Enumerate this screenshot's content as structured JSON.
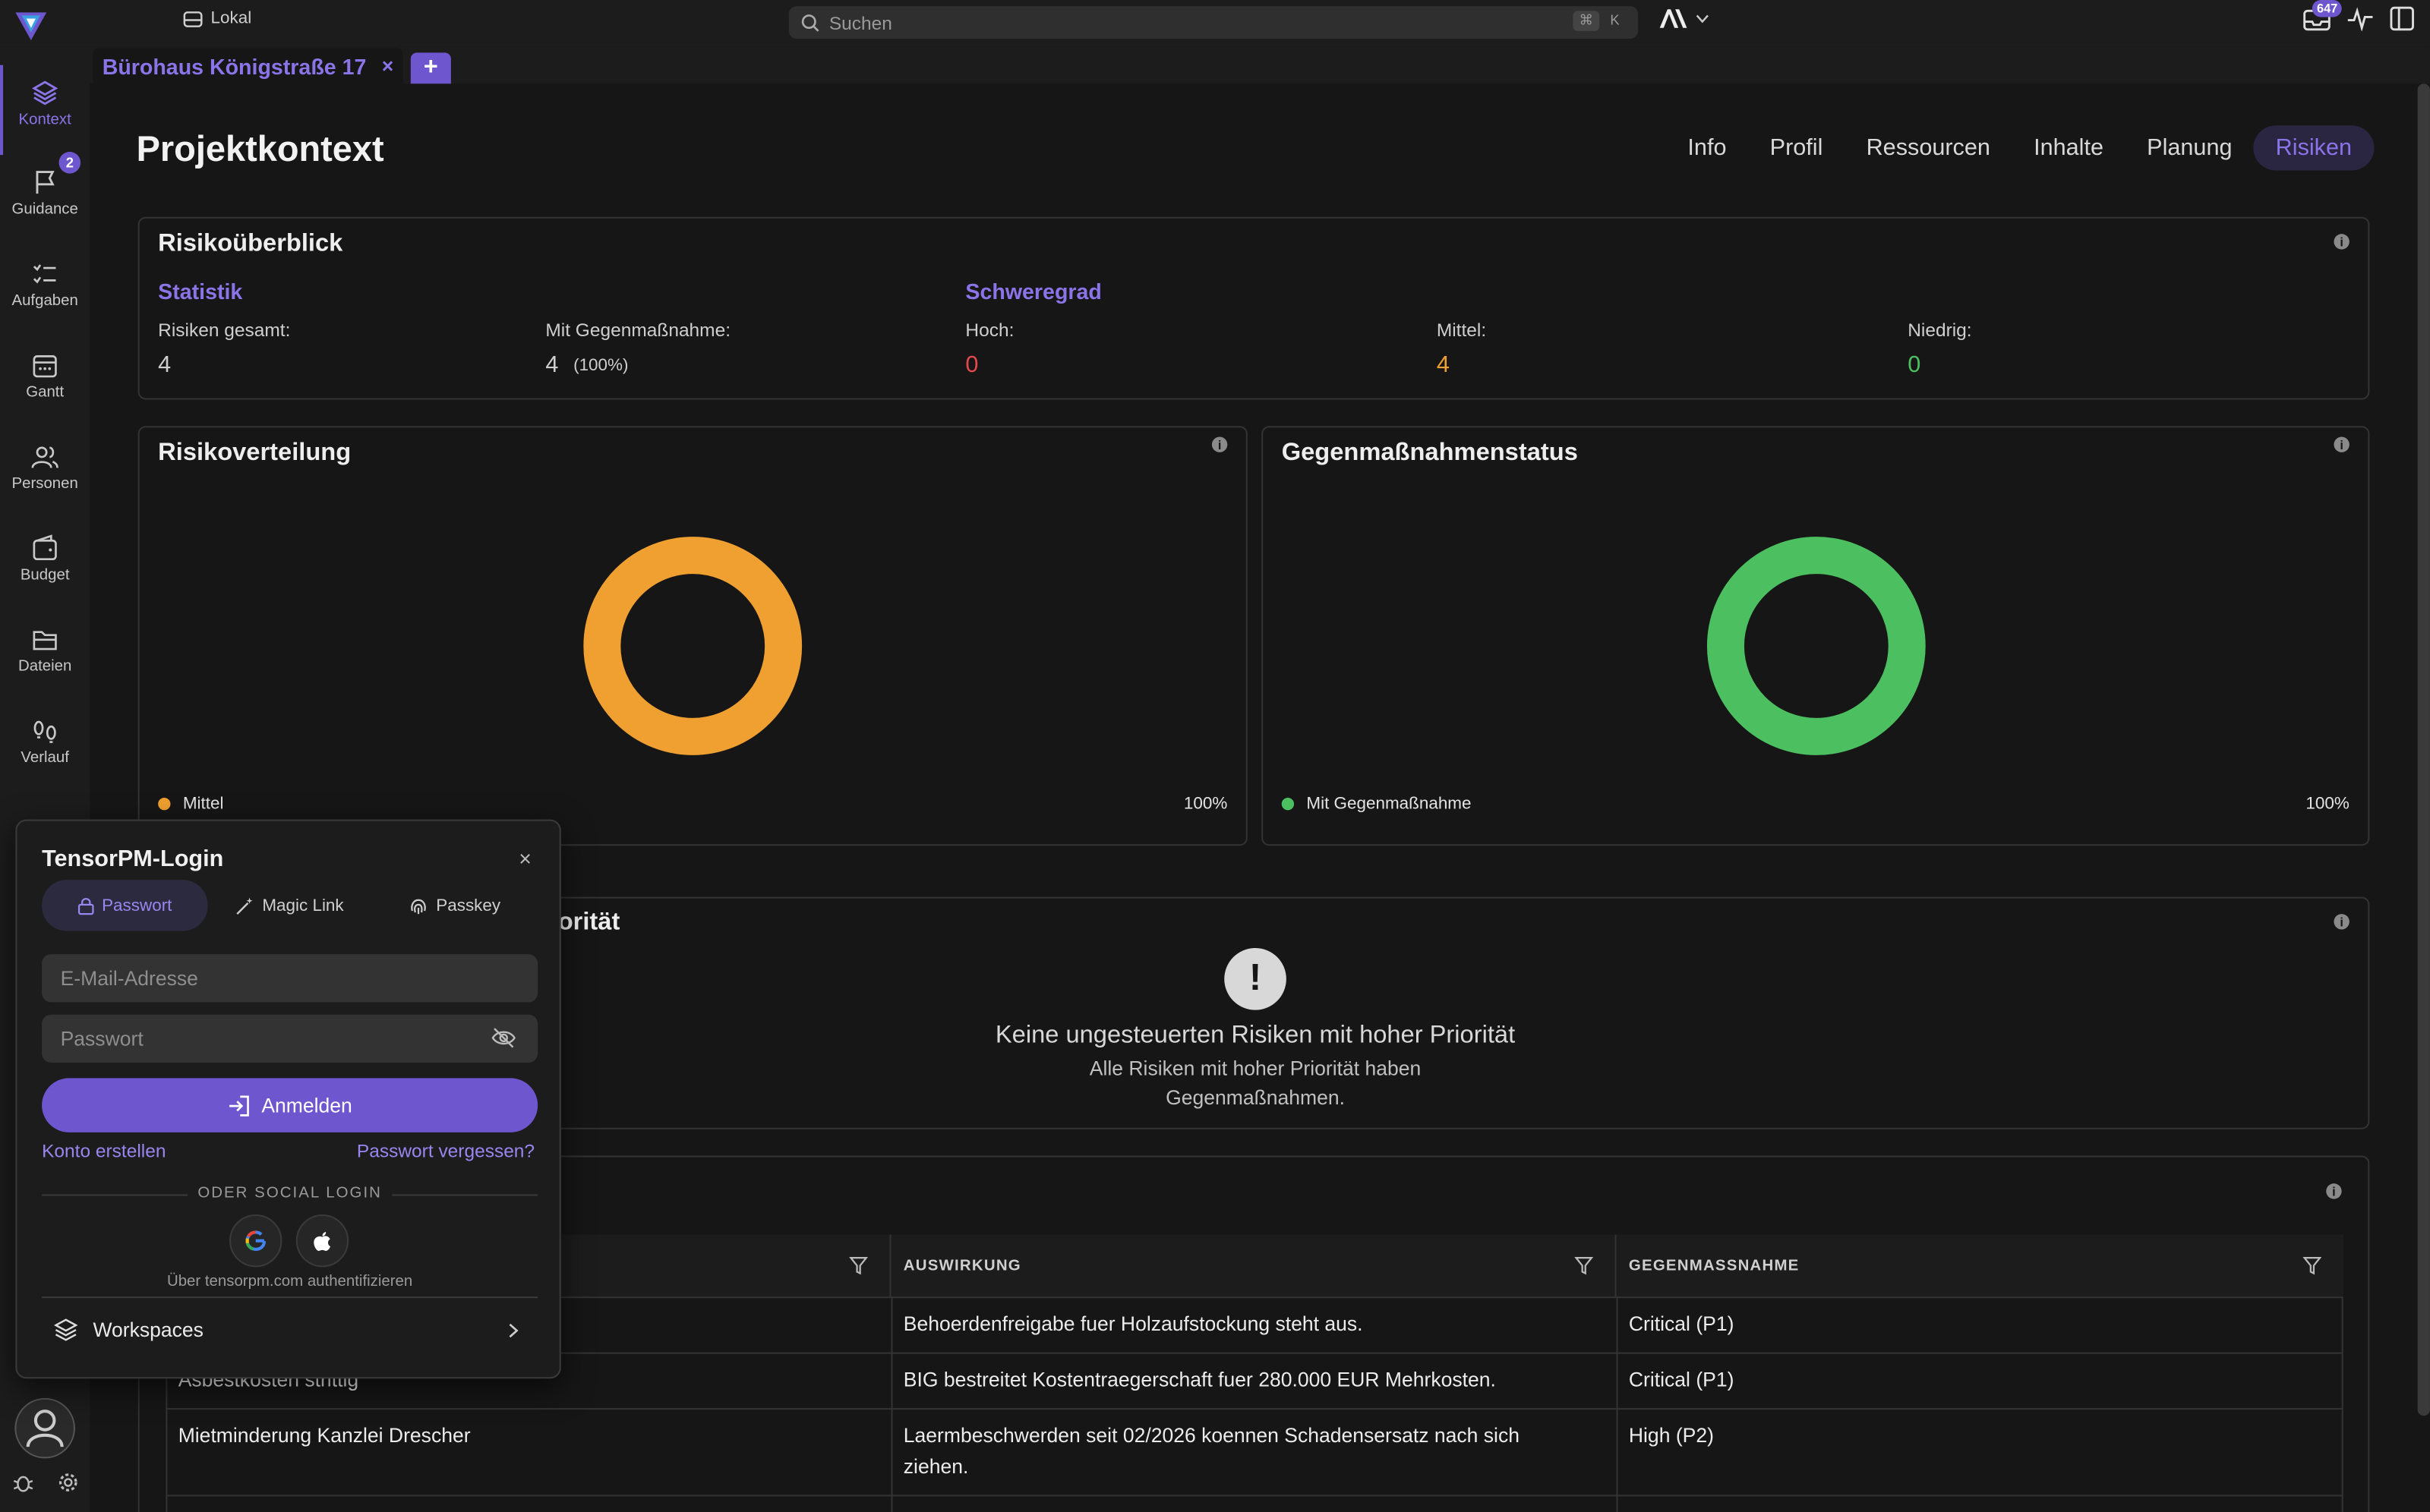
{
  "topbar": {
    "workspace": "Lokal",
    "search_placeholder": "Suchen",
    "shortcut_mod": "⌘",
    "shortcut_key": "K",
    "notifications_count": "647"
  },
  "tabs": {
    "active_tab": "Bürohaus Königstraße 17",
    "close": "×",
    "add": "+"
  },
  "sidebar": {
    "items": [
      {
        "label": "Kontext",
        "icon": "layers-icon"
      },
      {
        "label": "Guidance",
        "icon": "flag-icon",
        "badge": "2"
      },
      {
        "label": "Aufgaben",
        "icon": "checklist-icon"
      },
      {
        "label": "Gantt",
        "icon": "calendar-icon"
      },
      {
        "label": "Personen",
        "icon": "people-icon"
      },
      {
        "label": "Budget",
        "icon": "wallet-icon"
      },
      {
        "label": "Dateien",
        "icon": "folder-icon"
      },
      {
        "label": "Verlauf",
        "icon": "footsteps-icon"
      }
    ]
  },
  "page": {
    "title": "Projektkontext",
    "nav": [
      "Info",
      "Profil",
      "Ressourcen",
      "Inhalte",
      "Planung",
      "Risiken"
    ],
    "active_nav": "Risiken"
  },
  "overview": {
    "title": "Risikoüberblick",
    "statistik_title": "Statistik",
    "schweregrad_title": "Schweregrad",
    "total_label": "Risiken gesamt:",
    "total_value": "4",
    "mitigated_label": "Mit Gegenmaßnahme:",
    "mitigated_value": "4",
    "mitigated_pct": "(100%)",
    "hoch_label": "Hoch:",
    "hoch_value": "0",
    "mittel_label": "Mittel:",
    "mittel_value": "4",
    "niedrig_label": "Niedrig:",
    "niedrig_value": "0"
  },
  "distribution": {
    "title": "Risikoverteilung",
    "legend": "Mittel",
    "pct": "100%",
    "color": "#f0a030"
  },
  "status": {
    "title": "Gegenmaßnahmenstatus",
    "legend": "Mit Gegenmaßnahme",
    "pct": "100%",
    "color": "#4cc061"
  },
  "priority": {
    "title_visible": "orität",
    "empty_title": "Keine ungesteuerten Risiken mit hoher Priorität",
    "empty_line1": "Alle Risiken mit hoher Priorität haben",
    "empty_line2": "Gegenmaßnahmen."
  },
  "table": {
    "columns": [
      "AUSWIRKUNG",
      "GEGENMASSNAHME"
    ],
    "rows": [
      {
        "risk": "",
        "impact": "Behoerdenfreigabe fuer Holzaufstockung steht aus.",
        "measure": "Critical (P1)"
      },
      {
        "risk": "Asbestkosten strittig",
        "impact": "BIG bestreitet Kostentraegerschaft fuer 280.000 EUR Mehrkosten.",
        "measure": "Critical (P1)"
      },
      {
        "risk": "Mietminderung Kanzlei Drescher",
        "impact_line1": "Laermbeschwerden seit 02/2026 koennen Schadensersatz nach sich",
        "impact_line2": "ziehen.",
        "measure": "High (P2)"
      }
    ]
  },
  "login": {
    "title": "TensorPM-Login",
    "close": "×",
    "tabs": [
      "Passwort",
      "Magic Link",
      "Passkey"
    ],
    "email_placeholder": "E-Mail-Adresse",
    "password_placeholder": "Passwort",
    "submit": "Anmelden",
    "create_account": "Konto erstellen",
    "forgot": "Passwort vergessen?",
    "divider": "ODER SOCIAL LOGIN",
    "auth_note": "Über tensorpm.com authentifizieren",
    "workspaces": "Workspaces"
  },
  "colors": {
    "accent": "#6e56cf",
    "danger": "#e5484d",
    "warning": "#f0a030",
    "success": "#4cc061"
  }
}
